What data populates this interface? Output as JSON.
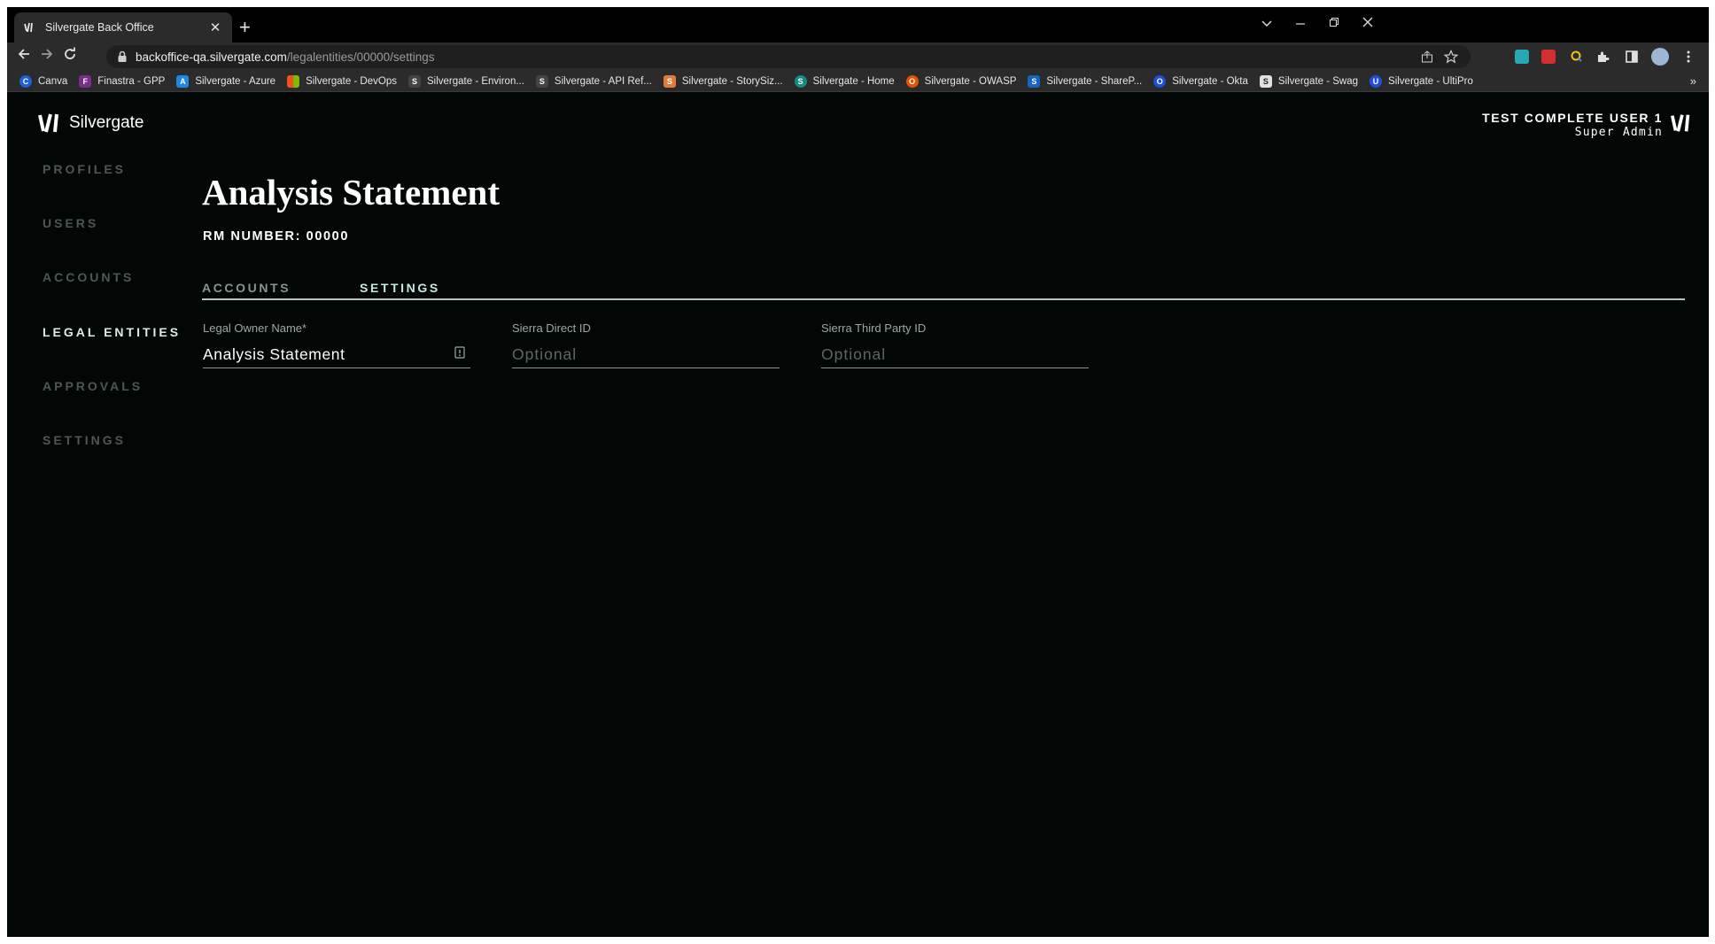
{
  "browser": {
    "tab_title": "Silvergate Back Office",
    "tab_close": "✕",
    "new_tab": "+",
    "url_host": "backoffice-qa.silvergate.com",
    "url_path": "/legalentities/00000/settings",
    "bookmarks_more": "»",
    "bookmarks": [
      {
        "label": "Canva",
        "color": "#1f5fd8",
        "icon": "C"
      },
      {
        "label": "Finastra - GPP",
        "color": "#7b2d8e",
        "icon": "F"
      },
      {
        "label": "Silvergate - Azure",
        "color": "#1e88e5",
        "icon": "A"
      },
      {
        "label": "Silvergate - DevOps",
        "color": "#f25022",
        "icon": ""
      },
      {
        "label": "Silvergate - Environ...",
        "color": "#2b2b2c",
        "icon": "S"
      },
      {
        "label": "Silvergate - API Ref...",
        "color": "#2b2b2c",
        "icon": "S"
      },
      {
        "label": "Silvergate - StorySiz...",
        "color": "#e07b39",
        "icon": "S"
      },
      {
        "label": "Silvergate - Home",
        "color": "#128c7e",
        "icon": "S"
      },
      {
        "label": "Silvergate - OWASP",
        "color": "#e65100",
        "icon": "O"
      },
      {
        "label": "Silvergate - ShareP...",
        "color": "#1565c0",
        "icon": "S"
      },
      {
        "label": "Silvergate - Okta",
        "color": "#1d4fd8",
        "icon": "O"
      },
      {
        "label": "Silvergate - Swag",
        "color": "#e0e0e0",
        "icon": "S"
      },
      {
        "label": "Silvergate - UltiPro",
        "color": "#1d4fd8",
        "icon": "U"
      }
    ]
  },
  "app": {
    "logo_text": "Silvergate",
    "user_name": "TEST COMPLETE USER 1",
    "user_role": "Super Admin",
    "nav": [
      {
        "label": "PROFILES",
        "active": false
      },
      {
        "label": "USERS",
        "active": false
      },
      {
        "label": "ACCOUNTS",
        "active": false
      },
      {
        "label": "LEGAL ENTITIES",
        "active": true
      },
      {
        "label": "APPROVALS",
        "active": false
      },
      {
        "label": "SETTINGS",
        "active": false
      }
    ],
    "page_title": "Analysis Statement",
    "rm_number": "RM NUMBER: 00000",
    "tabs": [
      {
        "label": "ACCOUNTS",
        "active": false
      },
      {
        "label": "SETTINGS",
        "active": true
      }
    ],
    "fields": {
      "legal_owner": {
        "label": "Legal Owner Name*",
        "value": "Analysis Statement"
      },
      "sierra_direct": {
        "label": "Sierra Direct ID",
        "placeholder": "Optional"
      },
      "sierra_third_party": {
        "label": "Sierra Third Party ID",
        "placeholder": "Optional"
      }
    }
  }
}
